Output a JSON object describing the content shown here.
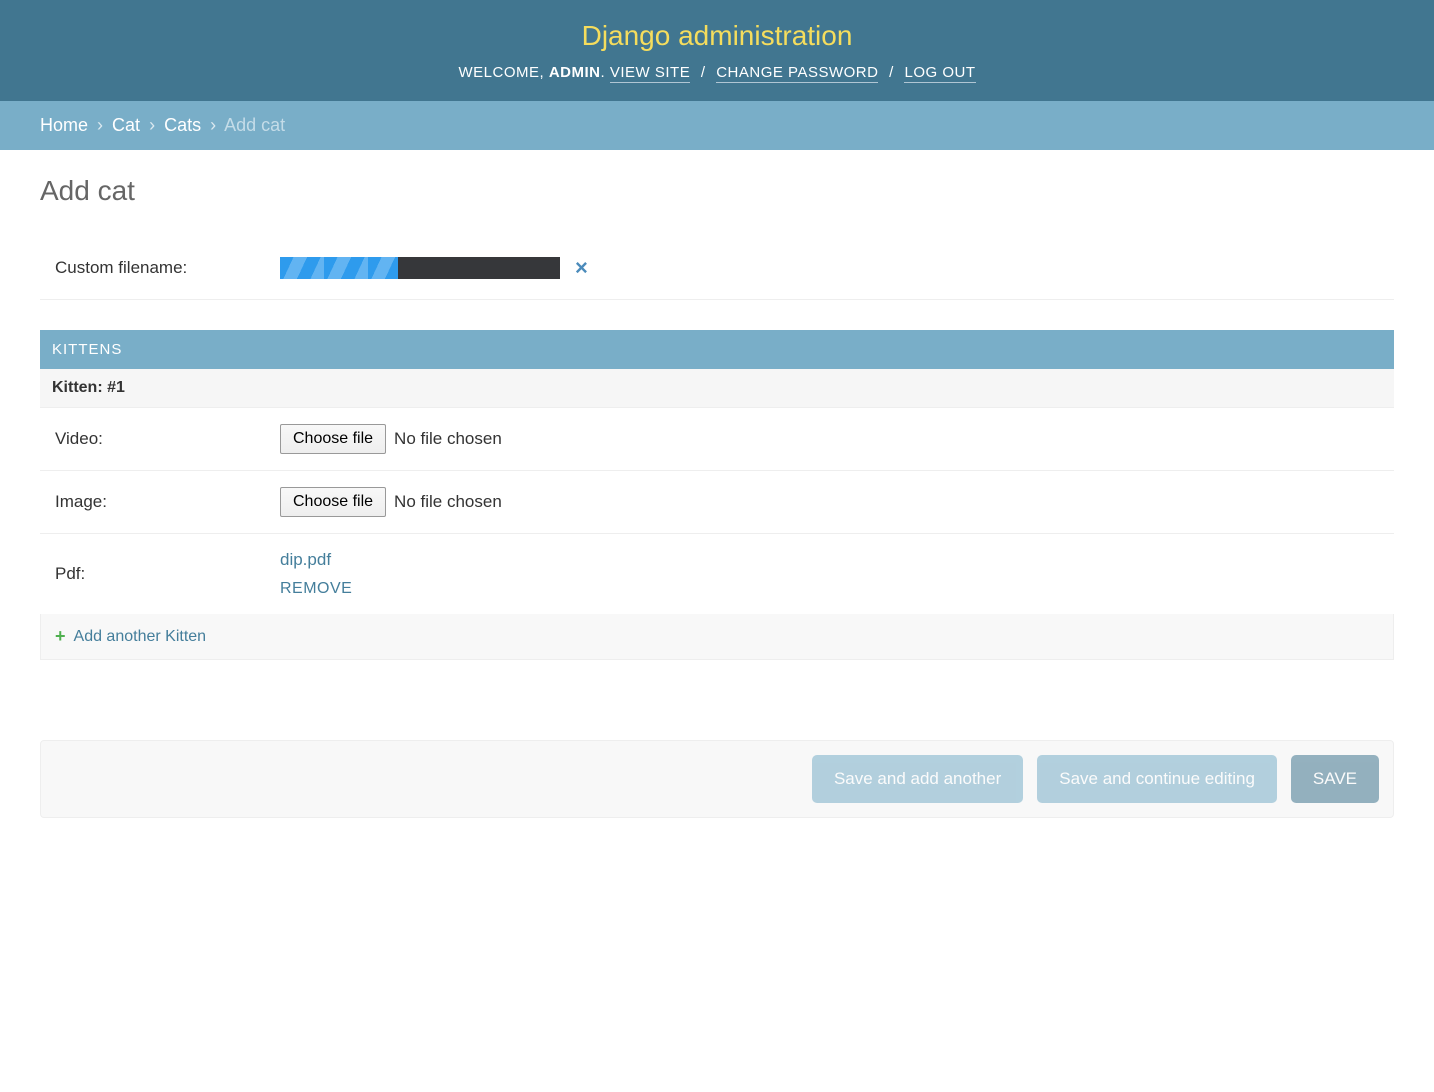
{
  "header": {
    "site_title": "Django administration",
    "welcome": "WELCOME, ",
    "username": "ADMIN",
    "dot": ". ",
    "view_site": "VIEW SITE",
    "change_password": "CHANGE PASSWORD",
    "log_out": "LOG OUT",
    "sep": " / "
  },
  "breadcrumbs": {
    "home": "Home",
    "app": "Cat",
    "model": "Cats",
    "current": "Add cat",
    "sep": "›"
  },
  "page": {
    "title": "Add cat"
  },
  "main_form": {
    "custom_filename_label": "Custom filename:",
    "progress_percent": 42,
    "cancel_symbol": "×"
  },
  "inline": {
    "section_title": "KITTENS",
    "item_title": "Kitten: #1",
    "video_label": "Video:",
    "image_label": "Image:",
    "pdf_label": "Pdf:",
    "choose_file": "Choose file",
    "no_file_chosen": "No file chosen",
    "pdf_filename": "dip.pdf",
    "remove_label": "REMOVE",
    "add_another": "Add another Kitten",
    "plus": "+"
  },
  "submit": {
    "save_add_another": "Save and add another",
    "save_continue": "Save and continue editing",
    "save": "SAVE"
  }
}
